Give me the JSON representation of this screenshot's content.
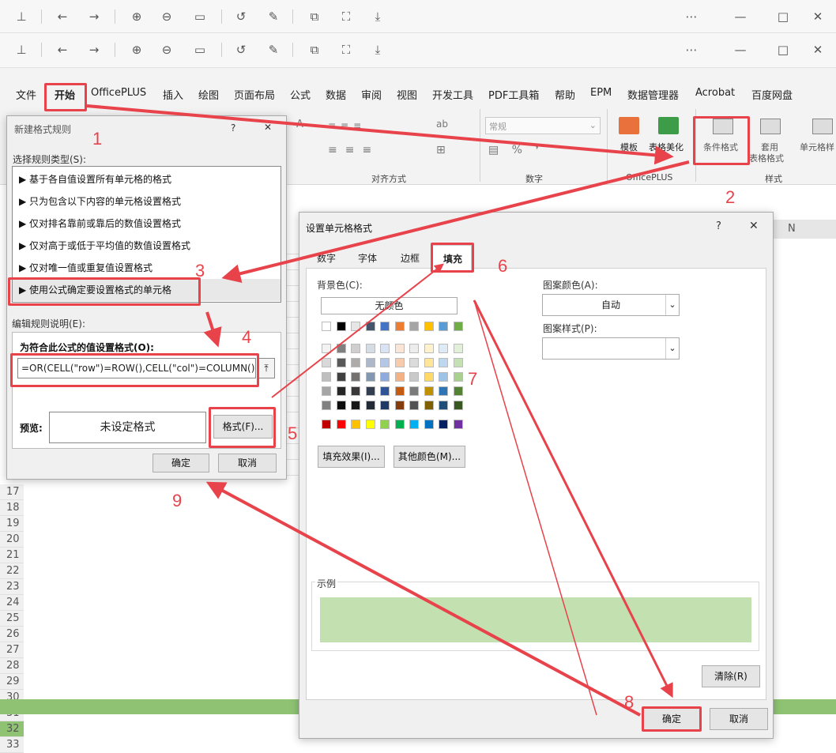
{
  "toolbar_icons": [
    "pin-icon",
    "back-icon",
    "forward-icon",
    "zoom-in-icon",
    "zoom-out-icon",
    "fit-icon",
    "rotate-icon",
    "edit-icon",
    "crop-icon",
    "fullscreen-icon",
    "download-icon",
    "more-icon",
    "minimize-icon",
    "maximize-icon",
    "close-icon"
  ],
  "menu": {
    "file": "文件",
    "home": "开始",
    "officeplus": "OfficePLUS",
    "insert": "插入",
    "draw": "绘图",
    "layout": "页面布局",
    "formula": "公式",
    "data": "数据",
    "review": "审阅",
    "view": "视图",
    "dev": "开发工具",
    "pdf": "PDF工具箱",
    "help": "帮助",
    "epm": "EPM",
    "dataman": "数据管理器",
    "acrobat": "Acrobat",
    "baidu": "百度网盘"
  },
  "ribbon": {
    "align_group": "对齐方式",
    "number_group": "数字",
    "number_format": "常规",
    "officeplus_group": "OfficePLUS",
    "style_group": "样式",
    "template": "模板",
    "table_beautify": "表格美化",
    "cond_format": "条件格式",
    "apply": "套用",
    "table_format": "表格格式",
    "cell_style": "单元格样"
  },
  "col_n": "N",
  "rows": [
    "17",
    "18",
    "19",
    "20",
    "21",
    "22",
    "23",
    "24",
    "25",
    "26",
    "27",
    "28",
    "29",
    "30",
    "31",
    "32",
    "33"
  ],
  "new_rule": {
    "title": "新建格式规则",
    "help": "?",
    "close": "✕",
    "select_type": "选择规则类型(S):",
    "rules": [
      "基于各自值设置所有单元格的格式",
      "只为包含以下内容的单元格设置格式",
      "仅对排名靠前或靠后的数值设置格式",
      "仅对高于或低于平均值的数值设置格式",
      "仅对唯一值或重复值设置格式",
      "使用公式确定要设置格式的单元格"
    ],
    "edit_desc": "编辑规则说明(E):",
    "formula_label": "为符合此公式的值设置格式(O):",
    "formula": "=OR(CELL(\"row\")=ROW(),CELL(\"col\")=COLUMN())",
    "preview_label": "预览:",
    "preview_text": "未设定格式",
    "format_btn": "格式(F)...",
    "ok": "确定",
    "cancel": "取消"
  },
  "format_cells": {
    "title": "设置单元格格式",
    "help": "?",
    "close": "✕",
    "tabs": [
      "数字",
      "字体",
      "边框",
      "填充"
    ],
    "bg_color": "背景色(C):",
    "no_color": "无颜色",
    "pattern_color": "图案颜色(A):",
    "pattern_color_value": "自动",
    "pattern_style": "图案样式(P):",
    "fill_effects": "填充效果(I)...",
    "more_colors": "其他颜色(M)...",
    "sample": "示例",
    "sample_color": "#c3e0b0",
    "clear": "清除(R)",
    "ok": "确定",
    "cancel": "取消"
  },
  "annotations": [
    "1",
    "2",
    "3",
    "4",
    "5",
    "6",
    "7",
    "8",
    "9"
  ],
  "colors": {
    "red": "#e8434b",
    "highlight_row": "#8fc373"
  }
}
